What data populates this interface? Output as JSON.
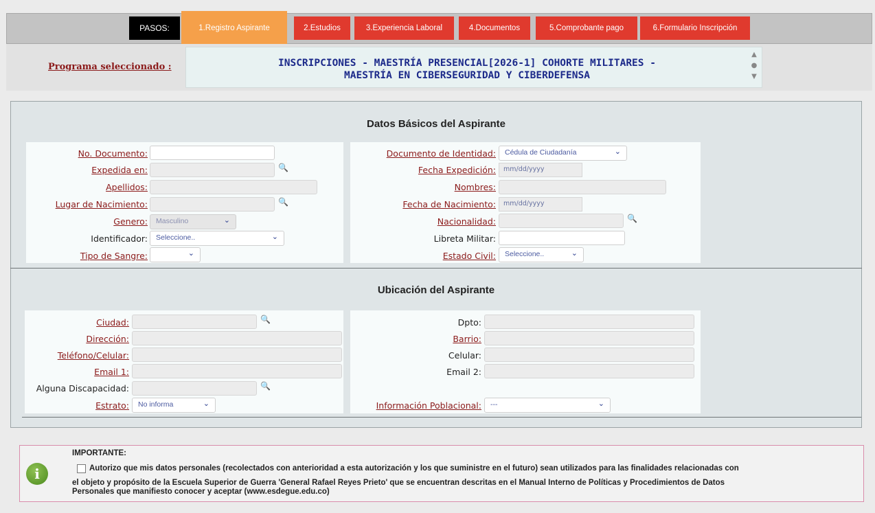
{
  "steps": {
    "label": "PASOS:",
    "tabs": [
      {
        "label": "1.Registro Aspirante",
        "active": true
      },
      {
        "label": "2.Estudios",
        "active": false
      },
      {
        "label": "3.Experiencia Laboral",
        "active": false
      },
      {
        "label": "4.Documentos",
        "active": false
      },
      {
        "label": "5.Comprobante pago",
        "active": false
      },
      {
        "label": "6.Formulario Inscripción",
        "active": false
      }
    ]
  },
  "program": {
    "label": "Programa seleccionado :",
    "title_line1": "INSCRIPCIONES - MAESTRÍA PRESENCIAL[2026-1] COHORTE MILITARES -",
    "title_line2": "MAESTRÍA EN CIBERSEGURIDAD Y CIBERDEFENSA"
  },
  "basic": {
    "title": "Datos Básicos del Aspirante",
    "no_documento": {
      "label": "No. Documento:",
      "value": ""
    },
    "expedida_en": {
      "label": "Expedida en:",
      "value": ""
    },
    "apellidos": {
      "label": "Apellidos:",
      "value": ""
    },
    "lugar_nacimiento": {
      "label": "Lugar de Nacimiento:",
      "value": ""
    },
    "genero": {
      "label": "Genero:",
      "value": "Masculino"
    },
    "identificador": {
      "label": "Identificador:",
      "value": "Seleccione.."
    },
    "tipo_sangre": {
      "label": "Tipo de Sangre:",
      "value": ""
    },
    "documento_identidad": {
      "label": "Documento de Identidad:",
      "value": "Cédula de Ciudadanía"
    },
    "fecha_expedicion": {
      "label": "Fecha Expedición:",
      "placeholder": "mm/dd/yyyy"
    },
    "nombres": {
      "label": "Nombres:",
      "value": ""
    },
    "fecha_nacimiento": {
      "label": "Fecha de Nacimiento:",
      "placeholder": "mm/dd/yyyy"
    },
    "nacionalidad": {
      "label": "Nacionalidad:",
      "value": ""
    },
    "libreta_militar": {
      "label": "Libreta Militar:",
      "value": ""
    },
    "estado_civil": {
      "label": "Estado Civil:",
      "value": "Seleccione.."
    }
  },
  "location": {
    "title": "Ubicación del Aspirante",
    "ciudad": {
      "label": "Ciudad:",
      "value": ""
    },
    "direccion": {
      "label": "Dirección:",
      "value": ""
    },
    "telefono": {
      "label": "Teléfono/Celular:",
      "value": ""
    },
    "email1": {
      "label": "Email 1:",
      "value": ""
    },
    "discapacidad": {
      "label": "Alguna Discapacidad:",
      "value": ""
    },
    "estrato": {
      "label": "Estrato:",
      "value": "No informa"
    },
    "dpto": {
      "label": "Dpto:",
      "value": ""
    },
    "barrio": {
      "label": "Barrio:",
      "value": ""
    },
    "celular": {
      "label": "Celular:",
      "value": ""
    },
    "email2": {
      "label": "Email 2:",
      "value": ""
    },
    "info_poblacional": {
      "label": "Información Poblacional:",
      "value": "---"
    }
  },
  "notice": {
    "title": "IMPORTANTE:",
    "line1": "Autorizo que mis datos personales (recolectados con anterioridad a esta autorización y los que suministre en el futuro) sean utilizados para las finalidades relacionadas con",
    "line2": "el objeto y propósito de la Escuela Superior de Guerra 'General Rafael Reyes Prieto' que se encuentran descritas en el Manual Interno de Políticas y Procedimientos de Datos",
    "line3": "Personales que manifiesto conocer y aceptar (www.esdegue.edu.co)",
    "checked": false
  },
  "colors": {
    "tab_red": "#e03a2e",
    "tab_active_orange": "#f5a04a",
    "required_label": "#8b1a1a",
    "program_title": "#1c2a8a"
  },
  "icons": {
    "search": "search-icon",
    "dropdown": "chevron-down-icon",
    "info": "info-icon",
    "scroll": "scroll-arrows-icon"
  }
}
